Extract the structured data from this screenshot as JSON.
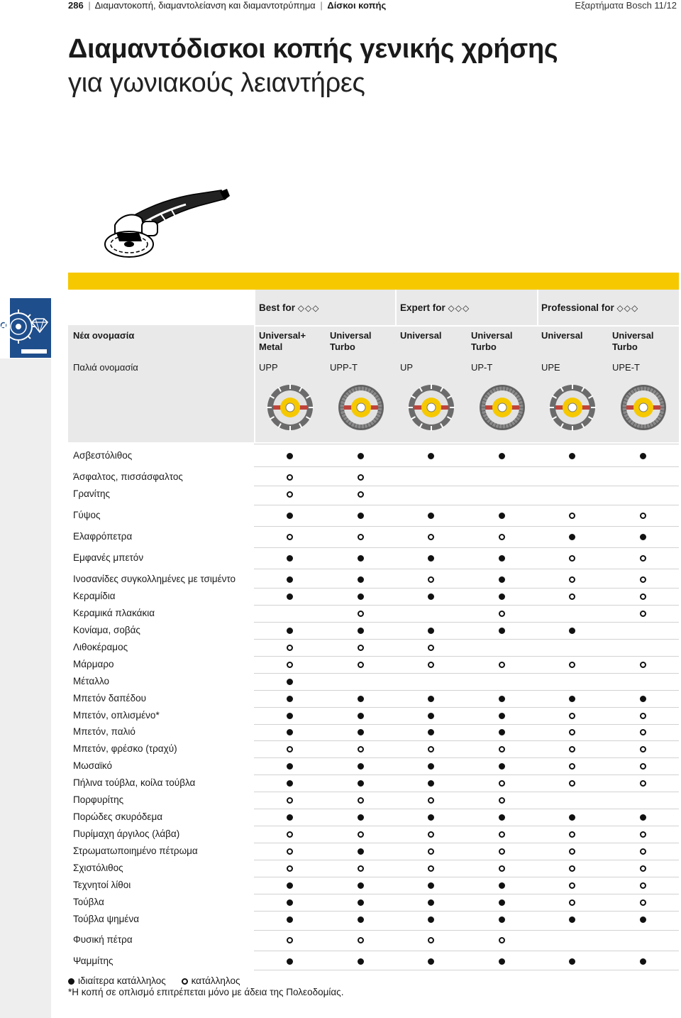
{
  "header": {
    "page_number": "286",
    "section": "Διαμαντοκοπή, διαμαντολείανση και διαμαντοτρύπημα",
    "subsection": "Δίσκοι κοπής",
    "right": "Εξαρτήματα Bosch 11/12",
    "separator": "|"
  },
  "title": "Διαμαντόδισκοι κοπής γενικής χρήσης",
  "subtitle": "για γωνιακούς λειαντήρες",
  "table": {
    "new_name_label": "Νέα ονομασία",
    "old_name_label": "Παλιά ονομασία",
    "groups": [
      {
        "label": "Best for",
        "diamond_icons": "💎💎💎"
      },
      {
        "label": "Expert for",
        "diamond_icons": "💎💎💎"
      },
      {
        "label": "Professional for",
        "diamond_icons": "💎💎💎"
      }
    ],
    "columns": [
      {
        "new_line1": "Universal+",
        "new_line2": "Metal",
        "old": "UPP"
      },
      {
        "new_line1": "Universal",
        "new_line2": "Turbo",
        "old": "UPP-T"
      },
      {
        "new_line1": "Universal",
        "new_line2": "",
        "old": "UP"
      },
      {
        "new_line1": "Universal",
        "new_line2": "Turbo",
        "old": "UP-T"
      },
      {
        "new_line1": "Universal",
        "new_line2": "",
        "old": "UPE"
      },
      {
        "new_line1": "Universal",
        "new_line2": "Turbo",
        "old": "UPE-T"
      }
    ],
    "rows": [
      {
        "label": "Ασβεστόλιθος",
        "marks": [
          "F",
          "F",
          "F",
          "F",
          "F",
          "F"
        ]
      },
      {
        "label": "Άσφαλτος, πισσάσφαλτος",
        "marks": [
          "O",
          "O",
          "",
          "",
          "",
          ""
        ]
      },
      {
        "label": "Γρανίτης",
        "marks": [
          "O",
          "O",
          "",
          "",
          "",
          ""
        ]
      },
      {
        "label": "Γύψος",
        "marks": [
          "F",
          "F",
          "F",
          "F",
          "O",
          "O"
        ]
      },
      {
        "label": "Ελαφρόπετρα",
        "marks": [
          "O",
          "O",
          "O",
          "O",
          "F",
          "F"
        ]
      },
      {
        "label": "Εμφανές μπετόν",
        "marks": [
          "F",
          "F",
          "F",
          "F",
          "O",
          "O"
        ]
      },
      {
        "label": "Ινοσανίδες συγκολλημένες με τσιμέντο",
        "marks": [
          "F",
          "F",
          "O",
          "F",
          "O",
          "O"
        ]
      },
      {
        "label": "Κεραμίδια",
        "marks": [
          "F",
          "F",
          "F",
          "F",
          "O",
          "O"
        ]
      },
      {
        "label": "Κεραμικά πλακάκια",
        "marks": [
          "",
          "O",
          "",
          "O",
          "",
          "O"
        ]
      },
      {
        "label": "Κονίαμα, σοβάς",
        "marks": [
          "F",
          "F",
          "F",
          "F",
          "F",
          ""
        ]
      },
      {
        "label": "Λιθοκέραμος",
        "marks": [
          "O",
          "O",
          "O",
          "",
          "",
          ""
        ]
      },
      {
        "label": "Μάρμαρο",
        "marks": [
          "O",
          "O",
          "O",
          "O",
          "O",
          "O"
        ]
      },
      {
        "label": "Μέταλλο",
        "marks": [
          "F",
          "",
          "",
          "",
          "",
          ""
        ]
      },
      {
        "label": "Μπετόν δαπέδου",
        "marks": [
          "F",
          "F",
          "F",
          "F",
          "F",
          "F"
        ]
      },
      {
        "label": "Μπετόν, οπλισμένο*",
        "marks": [
          "F",
          "F",
          "F",
          "F",
          "O",
          "O"
        ]
      },
      {
        "label": "Μπετόν, παλιό",
        "marks": [
          "F",
          "F",
          "F",
          "F",
          "O",
          "O"
        ]
      },
      {
        "label": "Μπετόν, φρέσκο (τραχύ)",
        "marks": [
          "O",
          "O",
          "O",
          "O",
          "O",
          "O"
        ]
      },
      {
        "label": "Μωσαϊκό",
        "marks": [
          "F",
          "F",
          "F",
          "F",
          "O",
          "O"
        ]
      },
      {
        "label": "Πήλινα τούβλα, κοίλα τούβλα",
        "marks": [
          "F",
          "F",
          "F",
          "O",
          "O",
          "O"
        ]
      },
      {
        "label": "Πορφυρίτης",
        "marks": [
          "O",
          "O",
          "O",
          "O",
          "",
          ""
        ]
      },
      {
        "label": "Πορώδες σκυρόδεμα",
        "marks": [
          "F",
          "F",
          "F",
          "F",
          "F",
          "F"
        ]
      },
      {
        "label": "Πυρίμαχη άργιλος (λάβα)",
        "marks": [
          "O",
          "O",
          "O",
          "O",
          "O",
          "O"
        ]
      },
      {
        "label": "Στρωματωποιημένο πέτρωμα",
        "marks": [
          "O",
          "F",
          "O",
          "O",
          "O",
          "O"
        ]
      },
      {
        "label": "Σχιστόλιθος",
        "marks": [
          "O",
          "O",
          "O",
          "O",
          "O",
          "O"
        ]
      },
      {
        "label": "Τεχνητοί λίθοι",
        "marks": [
          "F",
          "F",
          "F",
          "F",
          "O",
          "O"
        ]
      },
      {
        "label": "Τούβλα",
        "marks": [
          "F",
          "F",
          "F",
          "F",
          "O",
          "O"
        ]
      },
      {
        "label": "Τούβλα ψημένα",
        "marks": [
          "F",
          "F",
          "F",
          "F",
          "F",
          "F"
        ]
      },
      {
        "label": "Φυσική πέτρα",
        "marks": [
          "O",
          "O",
          "O",
          "O",
          "",
          ""
        ]
      },
      {
        "label": "Ψαμμίτης",
        "marks": [
          "F",
          "F",
          "F",
          "F",
          "F",
          "F"
        ]
      }
    ]
  },
  "legend": {
    "full_label": "ιδιαίτερα κατάλληλος",
    "open_label": "κατάλληλος"
  },
  "footnote": "*Η κοπή σε οπλισμό επιτρέπεται μόνο με άδεια της Πολεοδομίας.",
  "colors": {
    "accent_yellow": "#f6c800",
    "header_grey": "#e9e9e9",
    "side_blue": "#1f4e8c"
  },
  "icons": {
    "diamond": "diamond-icon",
    "disc": "diamond-disc-icon",
    "tool": "angle-grinder-illustration"
  }
}
